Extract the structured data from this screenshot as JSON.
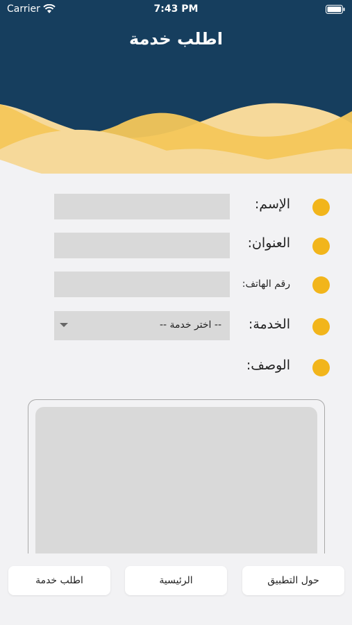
{
  "status_bar": {
    "carrier": "Carrier",
    "time": "7:43 PM"
  },
  "header": {
    "title": "اطلب خدمة",
    "colors": {
      "navy": "#163e5e",
      "wave": "#f4c75a",
      "wave_light": "#f6d99a"
    }
  },
  "form": {
    "name": {
      "label": "الإسم:",
      "value": ""
    },
    "address": {
      "label": "العنوان:",
      "value": ""
    },
    "phone": {
      "label": "رقم الهاتف:",
      "value": ""
    },
    "service": {
      "label": "الخدمة:",
      "selected": "-- اختر خدمة --"
    },
    "description": {
      "label": "الوصف:",
      "value": ""
    }
  },
  "tabs": {
    "about": "حول التطبيق",
    "home": "الرئيسية",
    "request": "اطلب خدمة"
  },
  "accent_color": "#f2b51b"
}
